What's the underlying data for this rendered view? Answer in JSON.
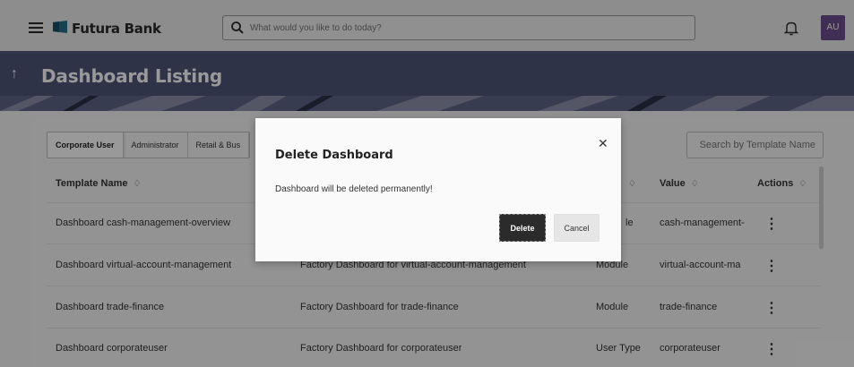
{
  "header": {
    "brand": "Futura Bank",
    "search_placeholder": "What would you like to do today?",
    "avatar_initials": "AU",
    "icons": [
      "hamburger-menu-icon",
      "bank-logo-icon",
      "search-icon",
      "bell-icon"
    ]
  },
  "page": {
    "title": "Dashboard Listing",
    "back_icon": "arrow-up-icon"
  },
  "tabs": [
    "Corporate User",
    "Administrator",
    "Retail & Bus"
  ],
  "active_tab": "Corporate User",
  "table_search_placeholder": "Search by Template Name",
  "table": {
    "columns": {
      "template_name": "Template Name",
      "type_sort": "♢",
      "value": "Value",
      "actions": "Actions",
      "sort_icon": "♢"
    },
    "rows": [
      {
        "name": "Dashboard cash-management-overview",
        "description": "",
        "type": "le",
        "value": "cash-management-"
      },
      {
        "name": "Dashboard virtual-account-management",
        "description": "Factory Dashboard for virtual-account-management",
        "type": "Module",
        "value": "virtual-account-ma"
      },
      {
        "name": "Dashboard trade-finance",
        "description": "Factory Dashboard for trade-finance",
        "type": "Module",
        "value": "trade-finance"
      },
      {
        "name": "Dashboard corporateuser",
        "description": "Factory Dashboard for corporateuser",
        "type": "User Type",
        "value": "corporateuser"
      }
    ],
    "row_action_glyph": "⋮"
  },
  "modal": {
    "title": "Delete Dashboard",
    "message": "Dashboard will be deleted permanently!",
    "delete_label": "Delete",
    "cancel_label": "Cancel",
    "close_glyph": "✕"
  },
  "colors": {
    "banner": "#4d5577",
    "avatar": "#6b4e8d",
    "primary_button": "#2b2b2b"
  }
}
